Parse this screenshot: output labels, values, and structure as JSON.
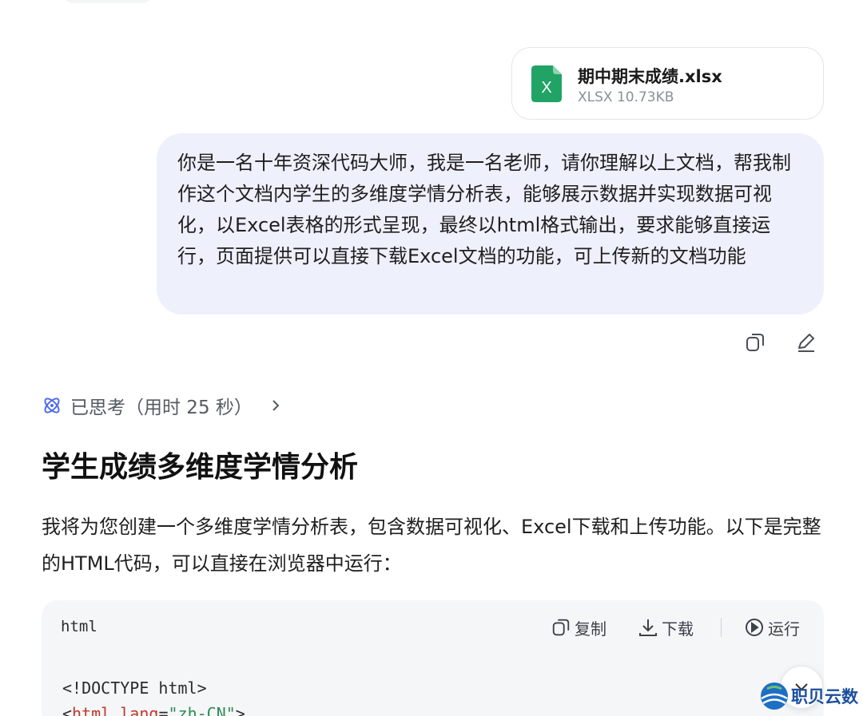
{
  "attachment": {
    "file_name": "期中期末成绩.xlsx",
    "file_meta": "XLSX 10.73KB",
    "icon": "excel-file-icon",
    "icon_letter": "X",
    "icon_color": "#21a366"
  },
  "user_message": {
    "text": "你是一名十年资深代码大师，我是一名老师，请你理解以上文档，帮我制作这个文档内学生的多维度学情分析表，能够展示数据并实现数据可视化，以Excel表格的形式呈现，最终以html格式输出，要求能够直接运行，页面提供可以直接下载Excel文档的功能，可上传新的文档功能",
    "actions": {
      "copy_icon": "copy-icon",
      "edit_icon": "edit-icon"
    }
  },
  "thinking": {
    "icon": "atom-icon",
    "label": "已思考（用时 25 秒）",
    "accent": "#4f6bed"
  },
  "answer": {
    "title": "学生成绩多维度学情分析",
    "paragraph": "我将为您创建一个多维度学情分析表，包含数据可视化、Excel下载和上传功能。以下是完整的HTML代码，可以直接在浏览器中运行："
  },
  "code_block": {
    "language": "html",
    "copy_label": "复制",
    "download_label": "下载",
    "run_label": "运行",
    "line1": "<!DOCTYPE html>",
    "line2_open": "<",
    "line2_tag": "html",
    "line2_attr": " lang",
    "line2_eq": "=",
    "line2_val": "\"zh-CN\"",
    "line2_close": ">"
  },
  "watermark": {
    "text": "职贝云数",
    "color": "#1d4f9c"
  }
}
